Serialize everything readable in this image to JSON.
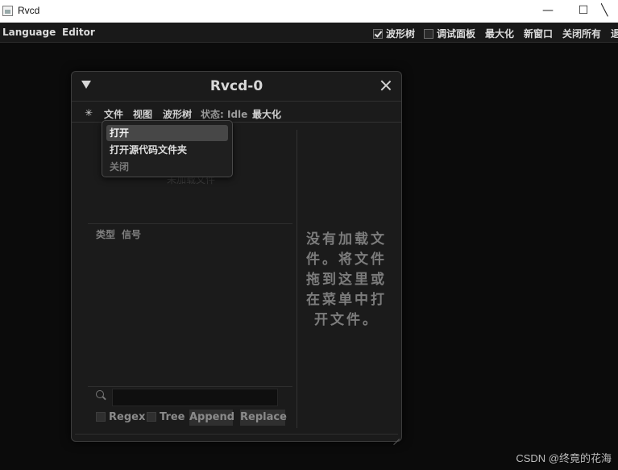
{
  "os": {
    "title": "Rvcd",
    "buttons": {
      "minimize": "—",
      "maximize": "☐",
      "close": "╲"
    }
  },
  "topbar": {
    "language": "Language",
    "editor": "Editor",
    "waveform_tree": {
      "label": "波形树",
      "checked": true
    },
    "debug_panel": {
      "label": "调试面板",
      "checked": false
    },
    "maximize": "最大化",
    "new_window": "新窗口",
    "close_all": "关闭所有",
    "cut_off": "退"
  },
  "window": {
    "title": "Rvcd-0",
    "menu": {
      "star": "✳",
      "file": "文件",
      "view": "视图",
      "waveform_tree": "波形树",
      "status": "状态: Idle",
      "maximize": "最大化"
    },
    "faded_text": "未加载文件",
    "columns": {
      "type": "类型",
      "signal": "信号"
    },
    "search": {
      "value": ""
    },
    "options": {
      "regex": {
        "label": "Regex",
        "checked": false
      },
      "tree": {
        "label": "Tree",
        "checked": false
      }
    },
    "buttons": {
      "append": "Append",
      "replace": "Replace"
    },
    "empty_message": "没有加载文件。将文件拖到这里或在菜单中打开文件。"
  },
  "dropdown": {
    "items": [
      {
        "label": "打开",
        "state": "hover"
      },
      {
        "label": "打开源代码文件夹",
        "state": "normal"
      },
      {
        "label": "关闭",
        "state": "disabled"
      }
    ]
  },
  "watermark": "CSDN @终竟的花海"
}
